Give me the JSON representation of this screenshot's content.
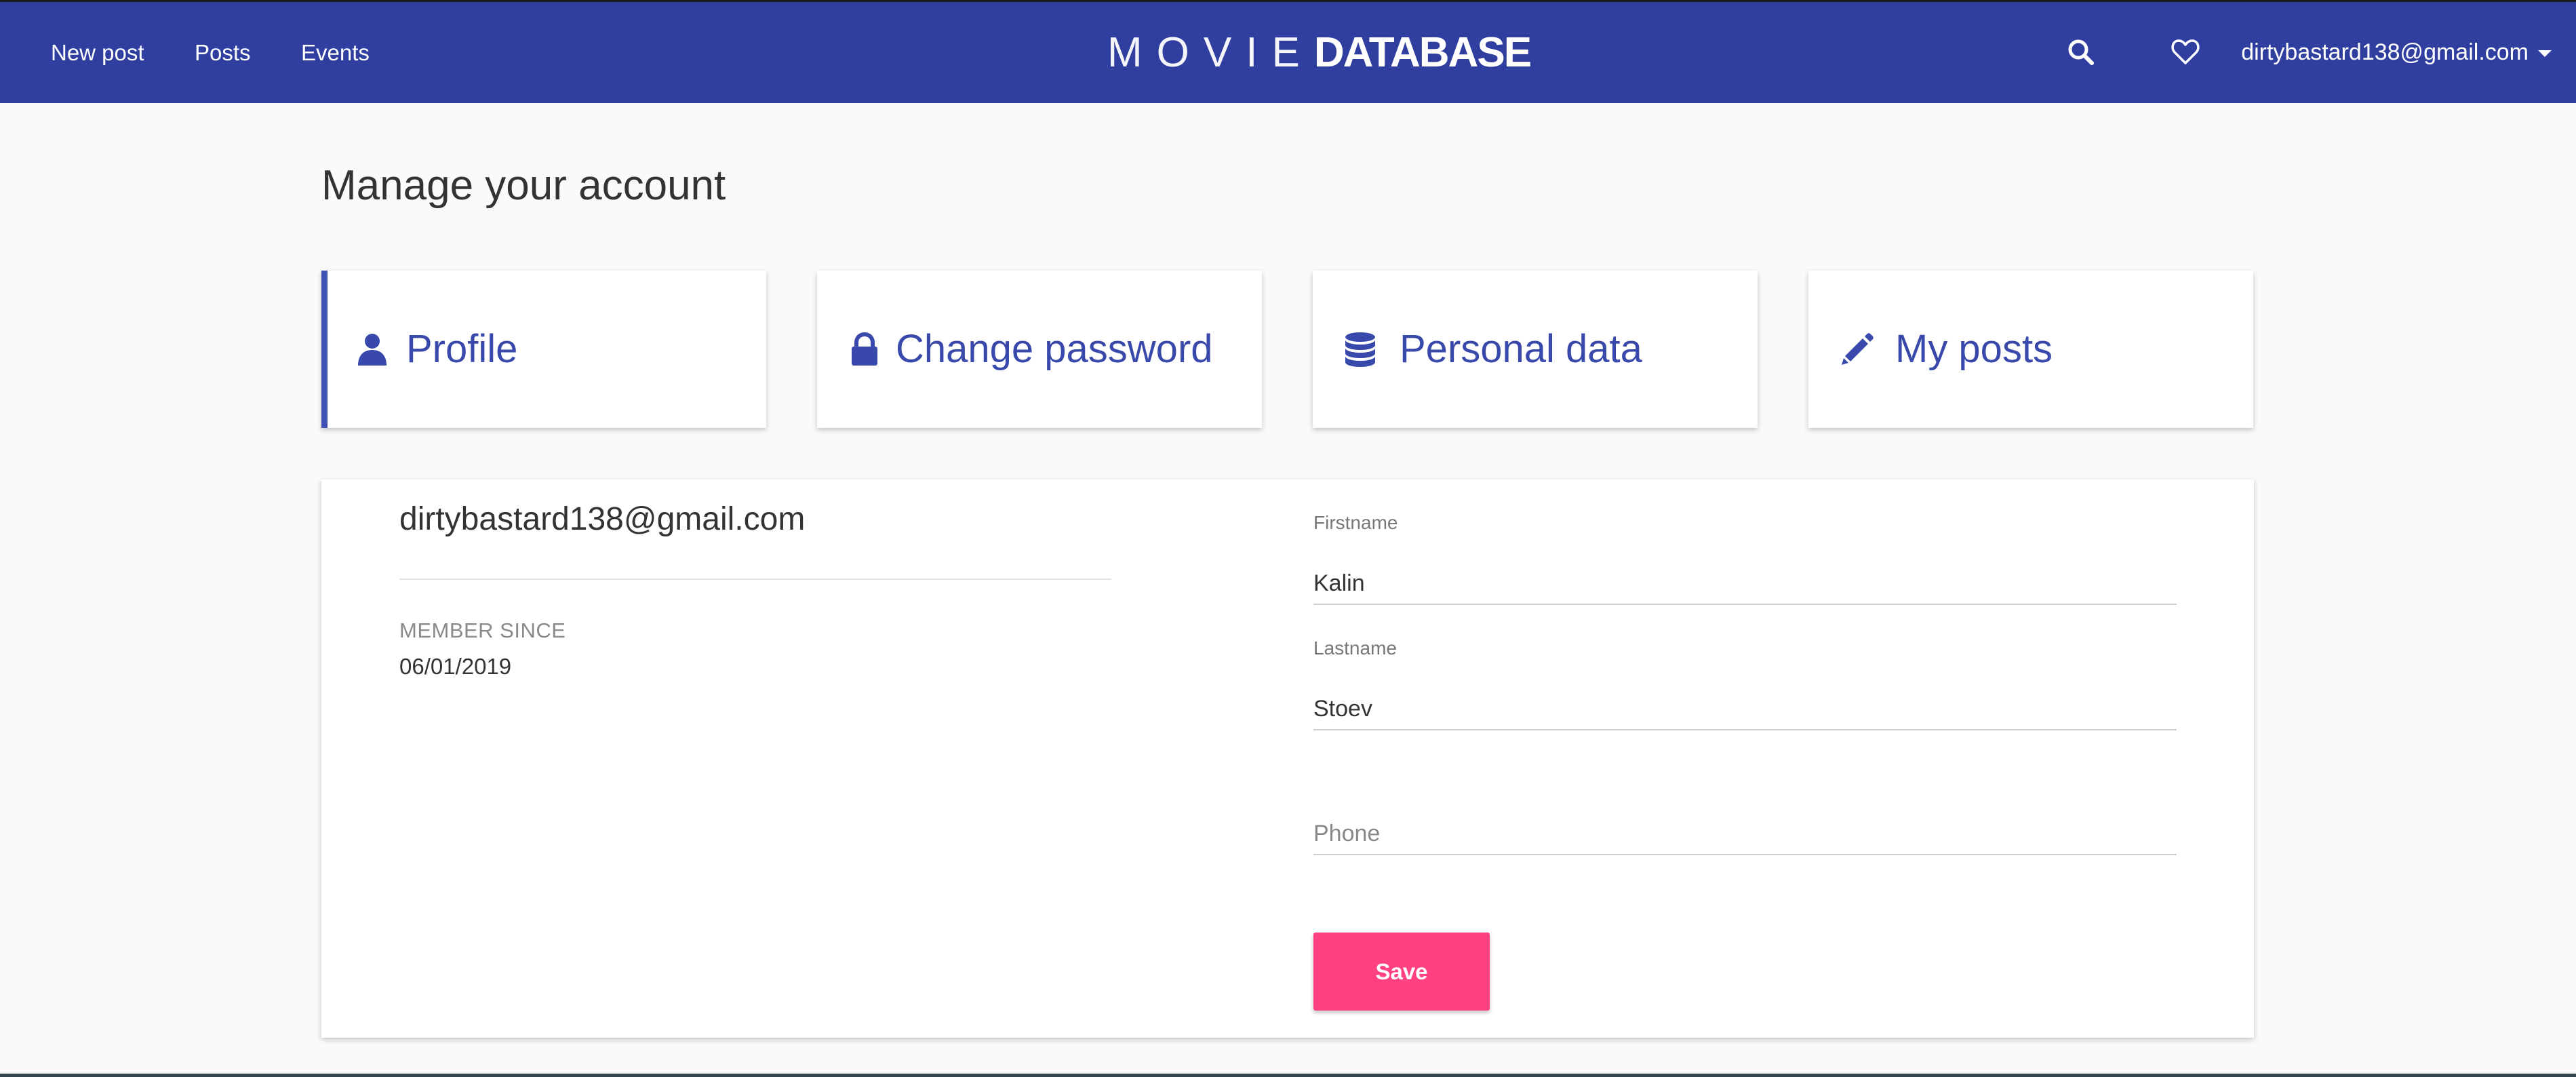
{
  "nav": {
    "links": [
      {
        "label": "New post"
      },
      {
        "label": "Posts"
      },
      {
        "label": "Events"
      }
    ],
    "brand": {
      "light": "MOVIE",
      "bold": "DATABASE"
    },
    "icons": {
      "search": "search-icon",
      "favorites": "heart-icon",
      "menu": "caret-down-icon"
    },
    "user_email": "dirtybastard138@gmail.com"
  },
  "page": {
    "title": "Manage your account"
  },
  "tabs": [
    {
      "label": "Profile",
      "icon": "user-icon",
      "active": true
    },
    {
      "label": "Change password",
      "icon": "lock-icon",
      "active": false
    },
    {
      "label": "Personal data",
      "icon": "database-icon",
      "active": false
    },
    {
      "label": "My posts",
      "icon": "pencil-icon",
      "active": false
    }
  ],
  "profile": {
    "email": "dirtybastard138@gmail.com",
    "member_since_label": "MEMBER SINCE",
    "member_since": "06/01/2019"
  },
  "form": {
    "firstname": {
      "label": "Firstname",
      "value": "Kalin"
    },
    "lastname": {
      "label": "Lastname",
      "value": "Stoev"
    },
    "phone": {
      "placeholder": "Phone",
      "value": ""
    },
    "save_label": "Save"
  },
  "colors": {
    "navbar": "#303f9f",
    "accent": "#3949ab",
    "save_button": "#ff4081",
    "background": "#fafafa"
  }
}
